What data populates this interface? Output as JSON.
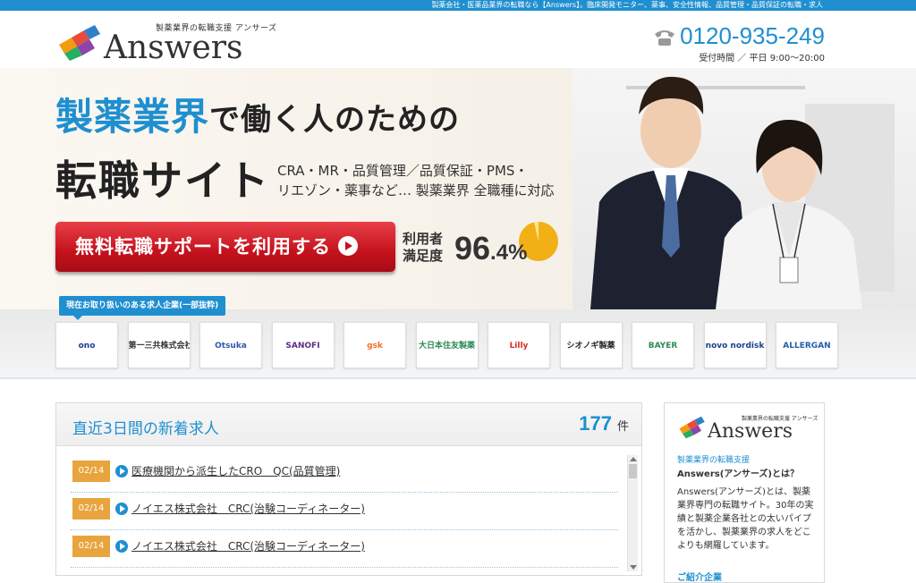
{
  "top_strip": {
    "text": "製薬会社・医薬品業界の転職なら【Answers】。臨床開発モニター、薬事、安全性情報、品質管理・品質保証の転職・求人"
  },
  "header": {
    "logo_tagline": "製薬業界の転職支援 アンサーズ",
    "logo_word": "Answers",
    "phone_number": "0120-935-249",
    "phone_hours": "受付時間 ／ 平日 9:00〜20:00"
  },
  "hero": {
    "headline_highlight": "製薬業界",
    "headline_rest": "で働く人のための",
    "headline_line2": "転職サイト",
    "sub_line1": "CRA・MR・品質管理／品質保証・PMS・",
    "sub_line2": "リエゾン・薬事など… 製薬業界 全職種に対応",
    "cta_label": "無料転職サポートを利用する",
    "satisfaction_label": "利用者満足度",
    "satisfaction_value_int": "96",
    "satisfaction_value_dec": ".4%",
    "satisfaction_value": 96.4
  },
  "companies": {
    "tag": "現在お取り扱いのある求人企業(一部抜粋)",
    "items": [
      {
        "label": "ono",
        "color": "#1a3f8f"
      },
      {
        "label": "第一三共株式会社",
        "color": "#333333"
      },
      {
        "label": "Otsuka",
        "color": "#2f5aa8"
      },
      {
        "label": "SANOFI",
        "color": "#5a2d82"
      },
      {
        "label": "gsk",
        "color": "#f36f21"
      },
      {
        "label": "大日本住友製薬",
        "color": "#2e8b57"
      },
      {
        "label": "Lilly",
        "color": "#d52b1e"
      },
      {
        "label": "シオノギ製薬",
        "color": "#222222"
      },
      {
        "label": "BAYER",
        "color": "#2e8b57"
      },
      {
        "label": "novo nordisk",
        "color": "#1a3f8f"
      },
      {
        "label": "ALLERGAN",
        "color": "#1f5fa8"
      }
    ]
  },
  "jobs": {
    "title": "直近3日間の新着求人",
    "count": "177",
    "count_unit": "件",
    "items": [
      {
        "date": "02/14",
        "title": "医療機関から派生したCRO　QC(品質管理)"
      },
      {
        "date": "02/14",
        "title": "ノイエス株式会社　CRC(治験コーディネーター)"
      },
      {
        "date": "02/14",
        "title": "ノイエス株式会社　CRC(治験コーディネーター)"
      }
    ]
  },
  "side": {
    "logo_tagline": "製薬業界の転職支援 アンサーズ",
    "logo_word": "Answers",
    "sub": "製薬業界の転職支援",
    "heading": "Answers(アンサーズ)とは？",
    "desc": "Answers(アンサーズ)とは、製薬業界専門の転職サイト。30年の実績と製薬企業各社との太いパイプを活かし、製薬業界の求人をどこよりも網羅しています。",
    "section": "ご紹介企業"
  }
}
